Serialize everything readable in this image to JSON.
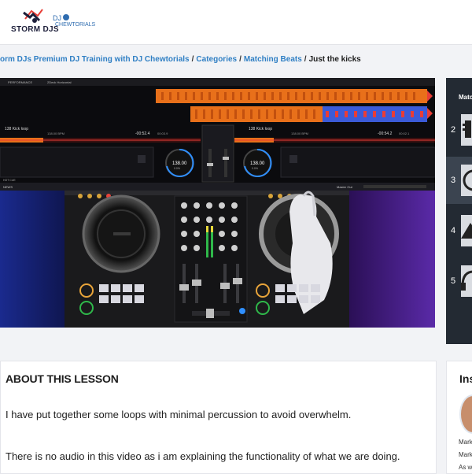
{
  "header": {
    "logo_text": "STORM DJS",
    "logo_sub": "CHEWTORIALS",
    "logo_dj": "DJ"
  },
  "breadcrumb": {
    "items": [
      {
        "label": "orm DJs Premium DJ Training with DJ Chewtorials"
      },
      {
        "label": "Categories"
      },
      {
        "label": "Matching Beats"
      }
    ],
    "current": "Just the kicks"
  },
  "video": {
    "performance_label": "PERFORMANCE",
    "layout_label": "2Deck Horizontal",
    "deck_left": {
      "title": "138 Kick loop",
      "time_neg": "-00:52.4",
      "time_pos": "00:03.9",
      "bpm": "138.00",
      "key": "138.00 BPM",
      "pitch": "0.0%"
    },
    "deck_right": {
      "title": "138 Kick loop",
      "time_neg": "-00:54.2",
      "time_pos": "00:02.1",
      "bpm": "138.00",
      "key": "138.00 BPM",
      "pitch": "0.0%"
    },
    "news_label": "NEWS",
    "hot_cue_label": "HOT CUE",
    "master_out_label": "Master Out",
    "colors": {
      "waveform_orange": "#e8701a",
      "waveform_blue": "#3b5bd8",
      "accent_red": "#e83d36"
    }
  },
  "sidebar": {
    "title": "Matc",
    "items": [
      {
        "num": "2",
        "icon": "microphone-icon"
      },
      {
        "num": "3",
        "icon": "metronome-icon"
      },
      {
        "num": "4",
        "icon": "mountain-icon"
      },
      {
        "num": "5",
        "icon": "headphones-icon"
      }
    ]
  },
  "about": {
    "heading": "ABOUT THIS LESSON",
    "para1": "I have put together some loops with minimal percussion to avoid overwhelm.",
    "para2": "There is no audio in this video as i am explaining the functionality of what we are doing."
  },
  "instructor": {
    "heading": "Ins",
    "line1": "Mark",
    "line2": "Mark",
    "line3": "As we"
  }
}
